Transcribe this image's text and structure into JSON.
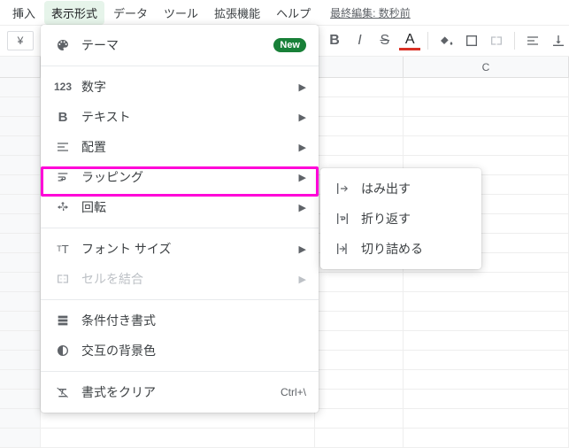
{
  "menubar": {
    "items": [
      "挿入",
      "表示形式",
      "データ",
      "ツール",
      "拡張機能",
      "ヘルプ"
    ],
    "active_index": 1,
    "last_edit": "最終編集: 数秒前"
  },
  "toolbar": {
    "currency": "¥"
  },
  "dropdown": {
    "theme": "テーマ",
    "new_badge": "New",
    "number": "数字",
    "text": "テキスト",
    "alignment": "配置",
    "wrapping": "ラッピング",
    "rotation": "回転",
    "fontsize": "フォント サイズ",
    "merge": "セルを結合",
    "conditional": "条件付き書式",
    "alternating": "交互の背景色",
    "clear": "書式をクリア",
    "clear_shortcut": "Ctrl+\\"
  },
  "submenu": {
    "overflow": "はみ出す",
    "wrap": "折り返す",
    "clip": "切り詰める"
  },
  "columns": {
    "c": "C"
  }
}
